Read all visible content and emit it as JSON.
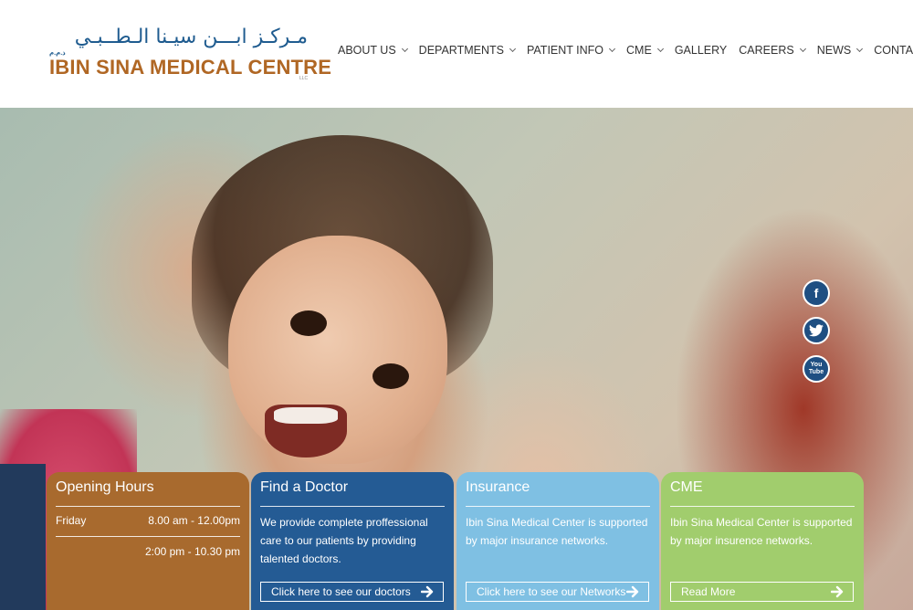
{
  "logo": {
    "arabic": "مـركـز ابـــن سيـنا الـطــبـي",
    "dhm": "ذ.م.م",
    "name": "IBIN SINA MEDICAL CENTRE",
    "llc": "LLC"
  },
  "nav": [
    {
      "label": "ABOUT US",
      "dropdown": true
    },
    {
      "label": "DEPARTMENTS",
      "dropdown": true
    },
    {
      "label": "PATIENT INFO",
      "dropdown": true
    },
    {
      "label": "CME",
      "dropdown": true
    },
    {
      "label": "GALLERY",
      "dropdown": false
    },
    {
      "label": "CAREERS",
      "dropdown": true
    },
    {
      "label": "NEWS",
      "dropdown": true
    },
    {
      "label": "CONTACT",
      "dropdown": false
    }
  ],
  "social": {
    "facebook": "f",
    "twitter": "t",
    "youtube": "You Tube"
  },
  "cards": {
    "opening_hours": {
      "title": "Opening Hours",
      "day": "Friday",
      "time1": "8.00 am - 12.00pm",
      "time2": "2:00 pm - 10.30 pm",
      "color": "#a86a2e"
    },
    "find_doctor": {
      "title": "Find a Doctor",
      "text": "We provide complete proffessional care to our patients by providing talented doctors.",
      "button": "Click here to see our doctors",
      "color": "#245b94"
    },
    "insurance": {
      "title": "Insurance",
      "text": "Ibin Sina Medical Center is supported by major insurance networks.",
      "button": "Click here to see our Networks",
      "color": "#7fc0e3"
    },
    "cme": {
      "title": "CME",
      "text": "Ibin Sina Medical Center is supported by major insurence networks.",
      "button": "Read More",
      "color": "#a1cd6d"
    }
  }
}
